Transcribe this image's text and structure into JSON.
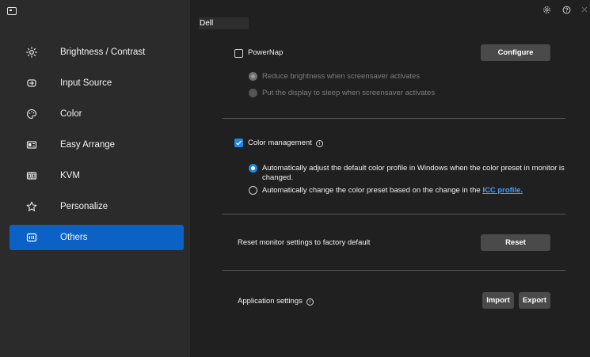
{
  "sidebar": {
    "items": [
      {
        "label": "Brightness / Contrast",
        "icon": "sun-icon"
      },
      {
        "label": "Input Source",
        "icon": "input-source-icon"
      },
      {
        "label": "Color",
        "icon": "palette-icon"
      },
      {
        "label": "Easy Arrange",
        "icon": "easy-arrange-icon"
      },
      {
        "label": "KVM",
        "icon": "kvm-icon"
      },
      {
        "label": "Personalize",
        "icon": "star-icon"
      },
      {
        "label": "Others",
        "icon": "others-icon",
        "active": true
      }
    ]
  },
  "header": {
    "monitor_label": "Dell"
  },
  "powernap": {
    "label": "PowerNap",
    "checked": false,
    "configure_label": "Configure",
    "options": [
      {
        "label": "Reduce brightness when screensaver activates",
        "selected": true
      },
      {
        "label": "Put the display to sleep when screensaver activates",
        "selected": false
      }
    ]
  },
  "color_management": {
    "label": "Color management",
    "checked": true,
    "option1_line1": "Automatically adjust the default color profile in Windows when the color preset in monitor is",
    "option1_line2": "changed.",
    "option2_text": "Automatically change the color preset based on the change in the",
    "option2_link": "ICC profile."
  },
  "reset": {
    "label": "Reset monitor settings to factory default",
    "button_label": "Reset"
  },
  "app_settings": {
    "label": "Application settings",
    "import_label": "Import",
    "export_label": "Export"
  },
  "colors": {
    "accent": "#0c62c4",
    "link": "#3ea2ff",
    "sidebar_bg": "#2b2b2b",
    "main_bg": "#202020"
  }
}
